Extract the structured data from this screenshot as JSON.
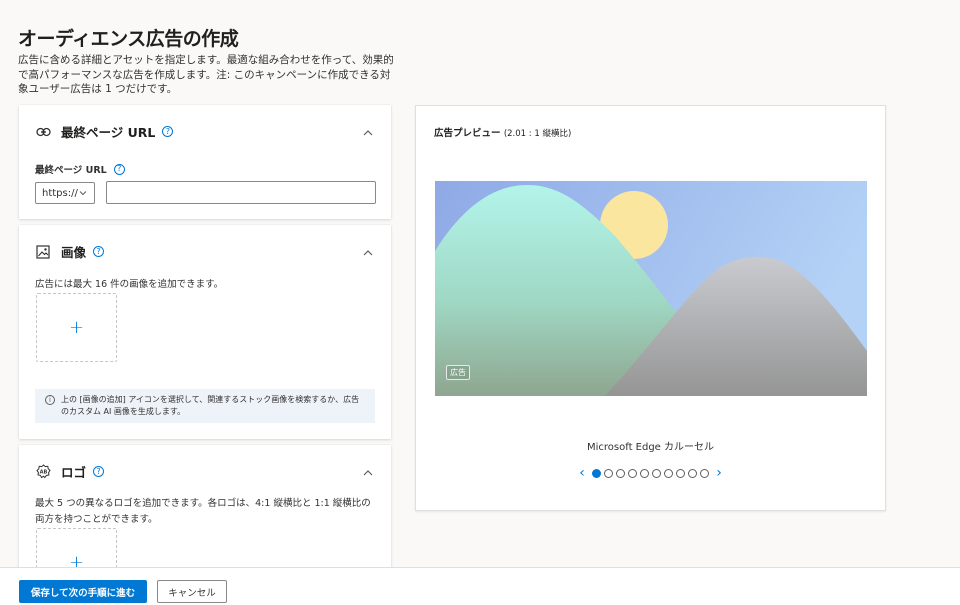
{
  "page": {
    "title": "オーディエンス広告の作成",
    "description": "広告に含める詳細とアセットを指定します。最適な組み合わせを作って、効果的で高パフォーマンスな広告を作成します。注: このキャンペーンに作成できる対象ユーザー広告は 1 つだけです。"
  },
  "final_url_card": {
    "title": "最終ページ URL",
    "field_label": "最終ページ URL",
    "protocol_value": "https://",
    "url_value": "",
    "url_placeholder": ""
  },
  "image_card": {
    "title": "画像",
    "description": "広告には最大 16 件の画像を追加できます。",
    "add_symbol": "+",
    "info_text": "上の [画像の追加] アイコンを選択して、関連するストック画像を検索するか、広告のカスタム AI 画像を生成します。"
  },
  "logo_card": {
    "title": "ロゴ",
    "description": "最大 5 つの異なるロゴを追加できます。各ロゴは、4:1 縦横比と 1:1 縦横比の両方を持つことができます。",
    "add_symbol": "+"
  },
  "preview": {
    "title": "広告プレビュー",
    "ratio": "(2.01 : 1 縦横比)",
    "ad_badge": "広告",
    "carousel_label": "Microsoft Edge カルーセル",
    "prev_arrow": "‹",
    "next_arrow": "›",
    "total_slides": 10,
    "active_slide": 1
  },
  "footer": {
    "save_label": "保存して次の手順に進む",
    "cancel_label": "キャンセル"
  },
  "colors": {
    "accent": "#0078d4",
    "background": "#faf9f8"
  },
  "icons": {
    "final_url": "link-icon",
    "image": "image-icon",
    "logo": "logo-icon",
    "help": "help-icon",
    "collapse": "chevron-up-icon",
    "info": "info-icon"
  }
}
